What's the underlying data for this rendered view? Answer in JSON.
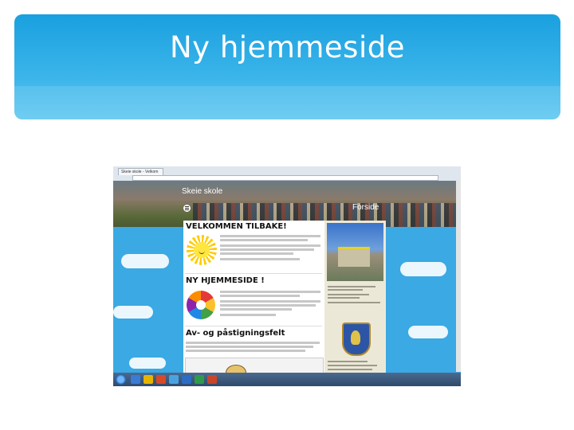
{
  "slide": {
    "title": "Ny hjemmeside"
  },
  "screenshot": {
    "browser_tab": "Skeie skole - Velkom",
    "site": {
      "name": "Skeie skole",
      "page_label": "Forside",
      "sections": [
        {
          "heading": "VELKOMMEN TILBAKE!"
        },
        {
          "heading": "NY HJEMMESIDE !"
        },
        {
          "heading": "Av- og påstigningsfelt"
        }
      ]
    }
  }
}
